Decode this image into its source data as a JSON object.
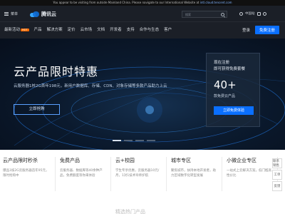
{
  "notice": {
    "text": "You appear to be visiting from outside Mainland China. Please navigate to our International Website at ",
    "link": "intl.cloud.tencent.com"
  },
  "header": {
    "menu_label": "菜单",
    "logo_text": "腾讯云",
    "search_placeholder": "搜索",
    "region_label": "中国站",
    "icons": [
      "globe-icon",
      "search-icon",
      "message-icon",
      "user-icon"
    ]
  },
  "nav": {
    "items": [
      {
        "label": "最新活动",
        "badge": "HOT"
      },
      {
        "label": "产品"
      },
      {
        "label": "解决方案"
      },
      {
        "label": "定价"
      },
      {
        "label": "云市场"
      },
      {
        "label": "文档"
      },
      {
        "label": "开发者"
      },
      {
        "label": "支持"
      },
      {
        "label": "合作与生态"
      },
      {
        "label": "客户"
      }
    ],
    "login_label": "登录",
    "signup_label": "免费注册"
  },
  "hero": {
    "title": "云产品限时特惠",
    "subtitle": "云服务器1核2G首年198元，新用户数据库、存储、CDN、对象存储等多款产品助力上云",
    "button_label": "立即抢购",
    "slides": 4,
    "active_slide": 1
  },
  "promo": {
    "line1": "现在注册",
    "line2": "即可获得免费套餐",
    "big": "40+",
    "line3": "款免费云产品",
    "button_label": "立即免费体验"
  },
  "cards": [
    {
      "title": "云产品限时秒杀",
      "desc": "爆品1核2G云服务器首年95元，限时抢购中"
    },
    {
      "title": "免费产品",
      "desc": "云服务器、数据库等40余种产品，免费额度等你来体验"
    },
    {
      "title": "云+校园",
      "desc": "学生专享优惠，云服务器10元/月，1对1技术导师护航"
    },
    {
      "title": "城市专区",
      "desc": "聚焦城市，扶持本地开发者，助力区域数字化转型发展"
    },
    {
      "title": "小微企业专区",
      "desc": "一站式上云解决方案，低门槛高性价比"
    }
  ],
  "float_tools": [
    "联系销售",
    "工单",
    "反馈"
  ],
  "section_peek": "精选热门产品",
  "colors": {
    "accent": "#0a6fff",
    "header_bg": "#1b1f27",
    "hero_bg": "#0b1a2e",
    "hot": "#ff6a00"
  }
}
